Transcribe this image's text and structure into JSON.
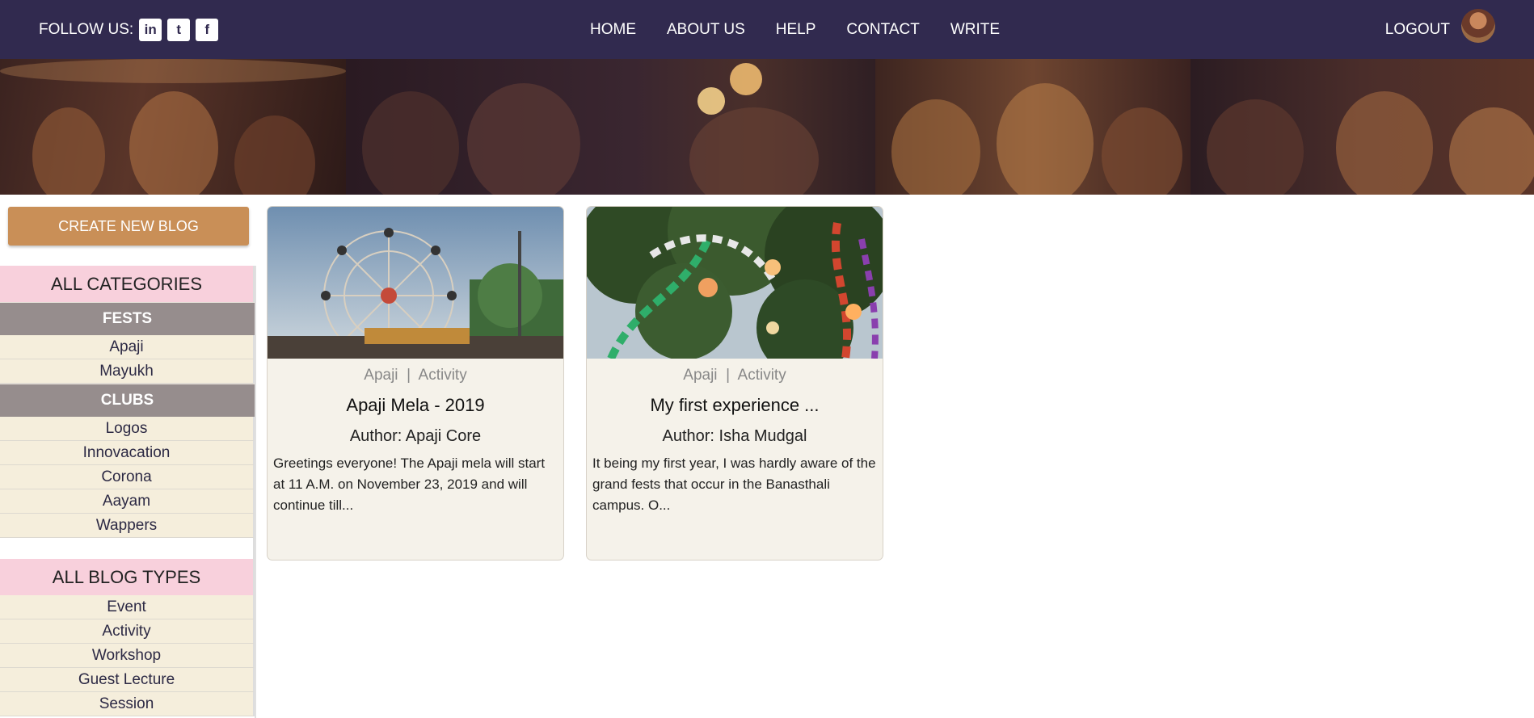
{
  "navbar": {
    "follow_label": "FOLLOW US:",
    "social": [
      {
        "icon": "linkedin-icon",
        "glyph": "in"
      },
      {
        "icon": "twitter-icon",
        "glyph": "t"
      },
      {
        "icon": "facebook-icon",
        "glyph": "f"
      }
    ],
    "links": [
      "HOME",
      "ABOUT US",
      "HELP",
      "CONTACT",
      "WRITE"
    ],
    "logout_label": "LOGOUT"
  },
  "sidebar": {
    "create_button": "CREATE NEW BLOG",
    "categories_heading": "ALL CATEGORIES",
    "fests_heading": "FESTS",
    "fests": [
      "Apaji",
      "Mayukh"
    ],
    "clubs_heading": "CLUBS",
    "clubs": [
      "Logos",
      "Innovacation",
      "Corona",
      "Aayam",
      "Wappers"
    ],
    "blog_types_heading": "ALL BLOG TYPES",
    "blog_types": [
      "Event",
      "Activity",
      "Workshop",
      "Guest Lecture",
      "Session"
    ]
  },
  "cards": [
    {
      "category": "Apaji",
      "separator": "|",
      "type": "Activity",
      "title": "Apaji Mela - 2019",
      "author": "Author: Apaji Core",
      "excerpt": "Greetings everyone! The Apaji mela will start at 11 A.M. on November 23, 2019 and will continue till..."
    },
    {
      "category": "Apaji",
      "separator": "|",
      "type": "Activity",
      "title": "My first experience ...",
      "author": "Author: Isha Mudgal",
      "excerpt": "It being my first year, I was hardly aware of the grand fests that occur in the Banasthali campus. O..."
    }
  ],
  "colors": {
    "navbar": "#312a4f",
    "create_button": "#c98f57",
    "section_heading": "#f8d0dc",
    "subheading": "#968d8d",
    "list_item": "#f5eedc",
    "card_bg": "#f5f2ea"
  }
}
